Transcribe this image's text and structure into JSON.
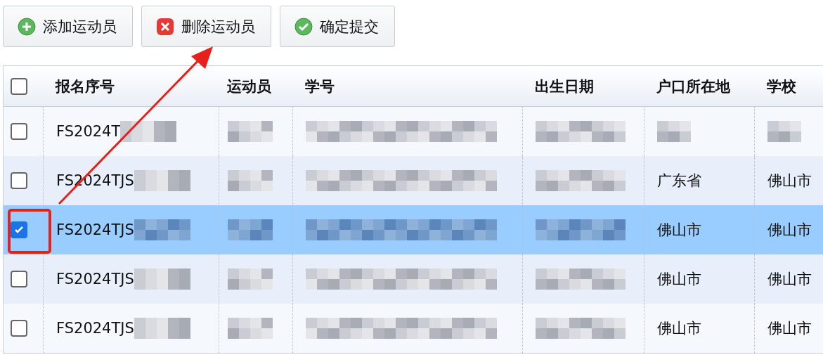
{
  "toolbar": [
    {
      "kind": "add",
      "label": "添加运动员"
    },
    {
      "kind": "delete",
      "label": "删除运动员"
    },
    {
      "kind": "confirm",
      "label": "确定提交"
    }
  ],
  "table": {
    "header_checked": false,
    "columns": [
      "报名序号",
      "运动员",
      "学号",
      "出生日期",
      "户口所在地",
      "学校"
    ],
    "rows": [
      {
        "checked": false,
        "selected": false,
        "cells": [
          {
            "text": "FS2024T",
            "redacted": true
          },
          {
            "redacted": true
          },
          {
            "redacted": true
          },
          {
            "redacted": true
          },
          {
            "redacted": true
          },
          {
            "redacted": true
          }
        ]
      },
      {
        "checked": false,
        "selected": false,
        "cells": [
          {
            "text": "FS2024TJS",
            "redacted": true
          },
          {
            "redacted": true
          },
          {
            "redacted": true
          },
          {
            "redacted": true
          },
          {
            "text": "广东省",
            "redacted": false
          },
          {
            "text": "佛山市",
            "redacted": false
          }
        ]
      },
      {
        "checked": true,
        "selected": true,
        "cells": [
          {
            "text": "FS2024TJS",
            "redacted": true
          },
          {
            "redacted": true
          },
          {
            "redacted": true
          },
          {
            "redacted": true
          },
          {
            "text": "佛山市",
            "redacted": false
          },
          {
            "text": "佛山市",
            "redacted": false
          }
        ]
      },
      {
        "checked": false,
        "selected": false,
        "cells": [
          {
            "text": "FS2024TJS",
            "redacted": true
          },
          {
            "redacted": true
          },
          {
            "redacted": true
          },
          {
            "redacted": true
          },
          {
            "text": "佛山市",
            "redacted": false
          },
          {
            "text": "佛山市",
            "redacted": false
          }
        ]
      },
      {
        "checked": false,
        "selected": false,
        "cells": [
          {
            "text": "FS2024TJS",
            "redacted": true
          },
          {
            "redacted": true
          },
          {
            "redacted": true
          },
          {
            "redacted": true
          },
          {
            "text": "佛山市",
            "redacted": false
          },
          {
            "text": "佛山市",
            "redacted": false
          }
        ]
      }
    ]
  }
}
